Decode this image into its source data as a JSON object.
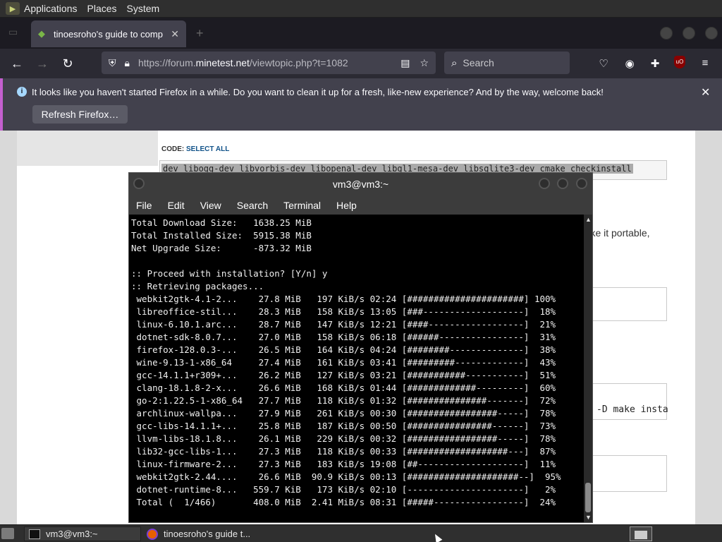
{
  "top_panel": {
    "menus": [
      "Applications",
      "Places",
      "System"
    ]
  },
  "firefox": {
    "tab": {
      "title": "tinoesroho's guide to comp"
    },
    "url_host": "https://forum.",
    "url_domain": "minetest.net",
    "url_path": "/viewtopic.php?t=1082",
    "search_placeholder": "Search",
    "notification": {
      "message": "It looks like you haven't started Firefox in a while. Do you want to clean it up for a fresh, like-new experience? And by the way, welcome back!",
      "button": "Refresh Firefox…"
    },
    "ublock_badge": "uO"
  },
  "page": {
    "code_label": "CODE:",
    "select_all": "SELECT ALL",
    "code_text": "dev libogg-dev libvorbis-dev libopenal-dev libgl1-mesa-dev libsqlite3-dev cmake checkinstall",
    "para_fragment": "make it portable,",
    "code_fragment": "-D make insta"
  },
  "terminal": {
    "title": "vm3@vm3:~",
    "menu": [
      "File",
      "Edit",
      "View",
      "Search",
      "Terminal",
      "Help"
    ],
    "lines": [
      "Total Download Size:   1638.25 MiB",
      "Total Installed Size:  5915.38 MiB",
      "Net Upgrade Size:      -873.32 MiB",
      "",
      ":: Proceed with installation? [Y/n] y",
      ":: Retrieving packages...",
      " webkit2gtk-4.1-2...    27.8 MiB   197 KiB/s 02:24 [######################] 100%",
      " libreoffice-stil...    28.3 MiB   158 KiB/s 13:05 [###-------------------]  18%",
      " linux-6.10.1.arc...    28.7 MiB   147 KiB/s 12:21 [####------------------]  21%",
      " dotnet-sdk-8.0.7...    27.0 MiB   158 KiB/s 06:18 [######----------------]  31%",
      " firefox-128.0.3-...    26.5 MiB   164 KiB/s 04:24 [########--------------]  38%",
      " wine-9.13-1-x86_64     27.4 MiB   161 KiB/s 03:41 [#########-------------]  43%",
      " gcc-14.1.1+r309+...    26.2 MiB   127 KiB/s 03:21 [###########-----------]  51%",
      " clang-18.1.8-2-x...    26.6 MiB   168 KiB/s 01:44 [#############---------]  60%",
      " go-2:1.22.5-1-x86_64   27.7 MiB   118 KiB/s 01:32 [###############-------]  72%",
      " archlinux-wallpa...    27.9 MiB   261 KiB/s 00:30 [#################-----]  78%",
      " gcc-libs-14.1.1+...    25.8 MiB   187 KiB/s 00:50 [################------]  73%",
      " llvm-libs-18.1.8...    26.1 MiB   229 KiB/s 00:32 [#################-----]  78%",
      " lib32-gcc-libs-1...    27.3 MiB   118 KiB/s 00:33 [###################---]  87%",
      " linux-firmware-2...    27.3 MiB   183 KiB/s 19:08 [##--------------------]  11%",
      " webkit2gtk-2.44....    26.6 MiB  90.9 KiB/s 00:13 [#####################--]  95%",
      " dotnet-runtime-8...   559.7 KiB   173 KiB/s 02:10 [----------------------]   2%",
      " Total (  1/466)       408.0 MiB  2.41 MiB/s 08:31 [#####-----------------]  24%"
    ]
  },
  "taskbar": {
    "items": [
      "vm3@vm3:~",
      "tinoesroho's guide t..."
    ]
  }
}
